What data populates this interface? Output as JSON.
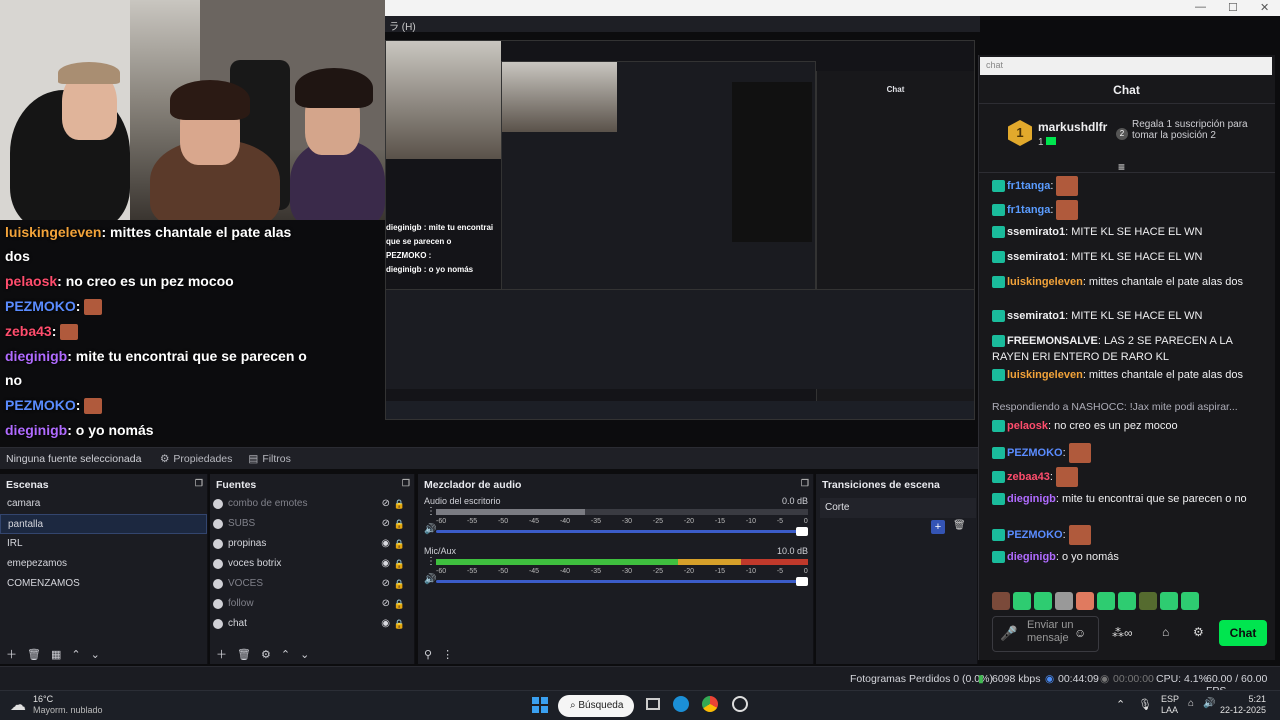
{
  "window": {
    "menu_fragment": "ラ (H)",
    "minimize": "—",
    "maximize": "☐",
    "close": "✕"
  },
  "overlay_chat": [
    {
      "user": "luiskingeleven",
      "user_color": "#f2a33a",
      "text": ": mittes chantale el pate alas dos",
      "emote": false
    },
    {
      "user": "pelaosk",
      "user_color": "#ff4d6d",
      "text": ": no creo es un pez mocoo",
      "emote": false
    },
    {
      "user": "PEZMOKO",
      "user_color": "#5a8cff",
      "text": ":",
      "emote": true
    },
    {
      "user": "zeba43",
      "user_color": "#ff4d6d",
      "text": ":",
      "emote": true
    },
    {
      "user": "dieginigb",
      "user_color": "#b06bff",
      "text": ": mite tu encontrai que se parecen o no",
      "emote": false
    },
    {
      "user": "PEZMOKO",
      "user_color": "#5a8cff",
      "text": ":",
      "emote": true
    },
    {
      "user": "dieginigb",
      "user_color": "#b06bff",
      "text": ": o yo nomás",
      "emote": false
    }
  ],
  "nested_preview": {
    "chat_title": "Chat",
    "lines": [
      "dieginigb : mite tu encontrai que se parecen o",
      "PEZMOKO :",
      "dieginigb : o yo nomás"
    ]
  },
  "properties_bar": {
    "no_source": "Ninguna fuente seleccionada",
    "properties": "Propiedades",
    "filters": "Filtros"
  },
  "scenes": {
    "title": "Escenas",
    "items": [
      "camara",
      "pantalla",
      "IRL",
      "emepezamos",
      "COMENZAMOS"
    ],
    "selected": 1
  },
  "sources": {
    "title": "Fuentes",
    "items": [
      {
        "name": "combo de emotes",
        "visible": false
      },
      {
        "name": "SUBS",
        "visible": false
      },
      {
        "name": "propinas",
        "visible": true
      },
      {
        "name": "voces botrix",
        "visible": true
      },
      {
        "name": "VOCES",
        "visible": false
      },
      {
        "name": "follow",
        "visible": false
      },
      {
        "name": "chat",
        "visible": true
      }
    ]
  },
  "mixer": {
    "title": "Mezclador de audio",
    "channels": [
      {
        "name": "Audio del escritorio",
        "db": "0.0 dB",
        "level": 0.0
      },
      {
        "name": "Mic/Aux",
        "db": "10.0 dB",
        "level": 1.0
      }
    ],
    "scale": [
      "-60",
      "-55",
      "-50",
      "-45",
      "-40",
      "-35",
      "-30",
      "-25",
      "-20",
      "-15",
      "-10",
      "-5",
      "0"
    ]
  },
  "transitions": {
    "title": "Transiciones de escena",
    "current": "Corte"
  },
  "status": {
    "dropped": "Fotogramas Perdidos 0 (0.0%)",
    "bitrate": "6098 kbps",
    "live_time": "00:44:09",
    "rec_time": "00:00:00",
    "cpu": "CPU: 4.1%",
    "fps": "60.00 / 60.00 FPS"
  },
  "taskbar": {
    "temp": "16°C",
    "weather": "Mayorm. nublado",
    "search": "Búsqueda",
    "lang1": "ESP",
    "lang2": "LAA",
    "time": "5:21",
    "date": "22-12-2025"
  },
  "chat": {
    "search_placeholder": "chat",
    "title": "Chat",
    "top_user": "markushdlfr",
    "top_count": "1",
    "gift_text": "Regala 1 suscripción para tomar la posición 2",
    "messages": [
      {
        "user": "fr1tanga",
        "color": "#5a9cff",
        "text": ":",
        "emote": true
      },
      {
        "user": "fr1tanga",
        "color": "#5a9cff",
        "text": ":",
        "emote": true
      },
      {
        "user": "ssemirato1",
        "color": "#efeff1",
        "text": ": MITE KL SE HACE EL WN",
        "emote": false
      },
      {
        "user": "ssemirato1",
        "color": "#efeff1",
        "text": ": MITE KL SE HACE EL WN",
        "emote": false
      },
      {
        "user": "luiskingeleven",
        "color": "#f2a33a",
        "text": ": mittes chantale el pate alas dos",
        "emote": false
      },
      {
        "user": "ssemirato1",
        "color": "#efeff1",
        "text": ": MITE KL SE HACE EL WN",
        "emote": false
      },
      {
        "user": "FREEMONSALVE",
        "color": "#efeff1",
        "text": ": LAS 2 SE PARECEN A LA RAYEN ERI ENTERO DE RARO KL",
        "emote": false
      },
      {
        "user": "luiskingeleven",
        "color": "#f2a33a",
        "text": ": mittes chantale el pate alas dos",
        "emote": false
      }
    ],
    "reply_line": "Respondiendo a NASHOCC: !Jax mite podi aspirar...",
    "messages2": [
      {
        "user": "pelaosk",
        "color": "#ff4d6d",
        "text": ": no creo es un pez mocoo",
        "emote": false
      },
      {
        "user": "PEZMOKO",
        "color": "#5a8cff",
        "text": ":",
        "emote": true
      },
      {
        "user": "zebaa43",
        "color": "#ff4d6d",
        "text": ":",
        "emote": true
      },
      {
        "user": "dieginigb",
        "color": "#b06bff",
        "text": ": mite tu encontrai que se parecen o no",
        "emote": false
      },
      {
        "user": "PEZMOKO",
        "color": "#5a8cff",
        "text": ":",
        "emote": true
      },
      {
        "user": "dieginigb",
        "color": "#b06bff",
        "text": ": o yo nomás",
        "emote": false
      }
    ],
    "input_placeholder": "Enviar un mensaje",
    "send_label": "Chat"
  }
}
